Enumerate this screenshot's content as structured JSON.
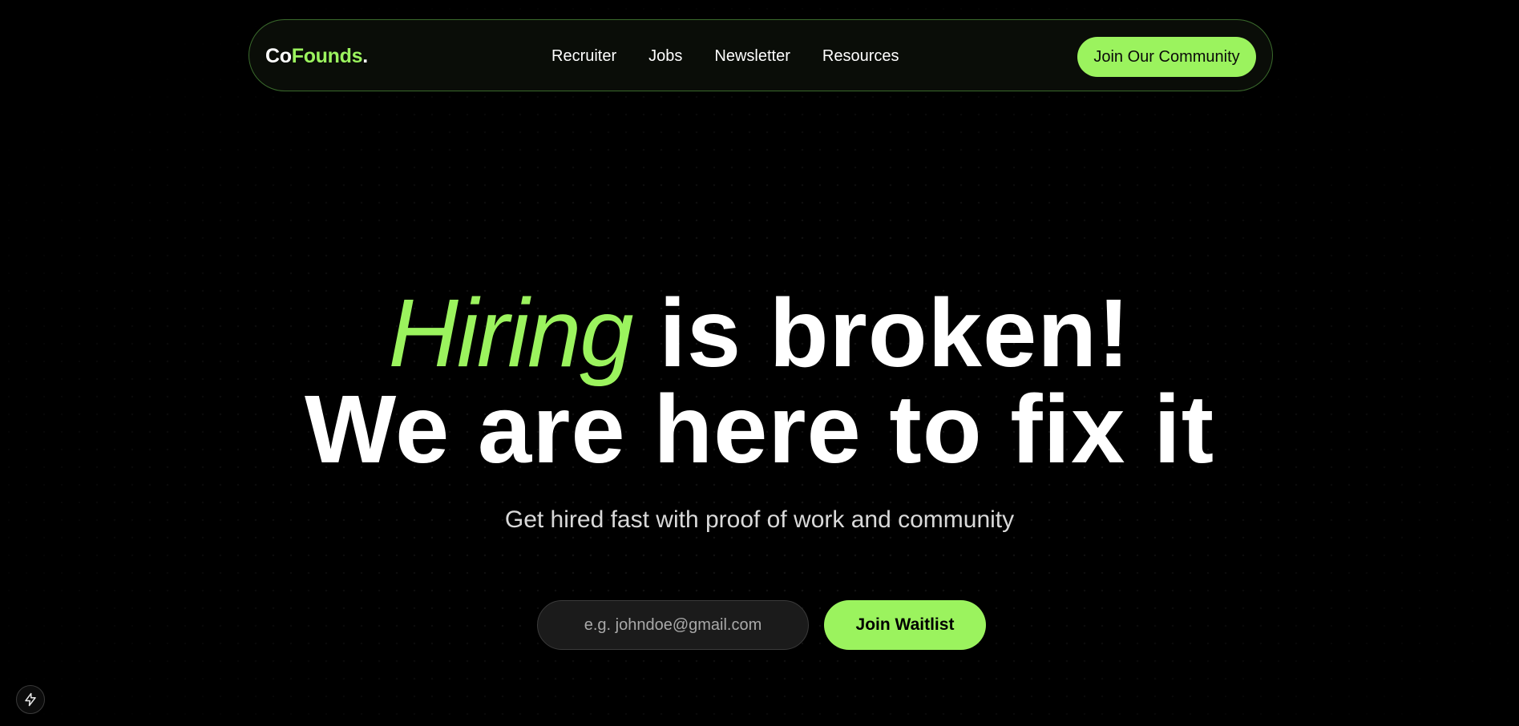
{
  "colors": {
    "background": "#000000",
    "accent": "#9bf35e",
    "nav_border": "#3a6a2c",
    "text": "#ffffff",
    "subtitle": "#d9d9d9",
    "input_background": "#1b1b1b"
  },
  "nav": {
    "logo": {
      "part_a": "Co",
      "part_b": "Founds",
      "part_c": "."
    },
    "links": [
      "Recruiter",
      "Jobs",
      "Newsletter",
      "Resources"
    ],
    "cta_label": "Join Our Community"
  },
  "hero": {
    "headline_accent": "Hiring",
    "headline_rest": "is broken!",
    "headline_line2": "We are here to fix it",
    "subtitle": "Get hired fast with proof of work and community"
  },
  "signup": {
    "email_placeholder": "e.g. johndoe@gmail.com",
    "email_value": "",
    "button_label": "Join Waitlist"
  },
  "corner_badge": {
    "icon": "lightning-bolt-icon"
  }
}
